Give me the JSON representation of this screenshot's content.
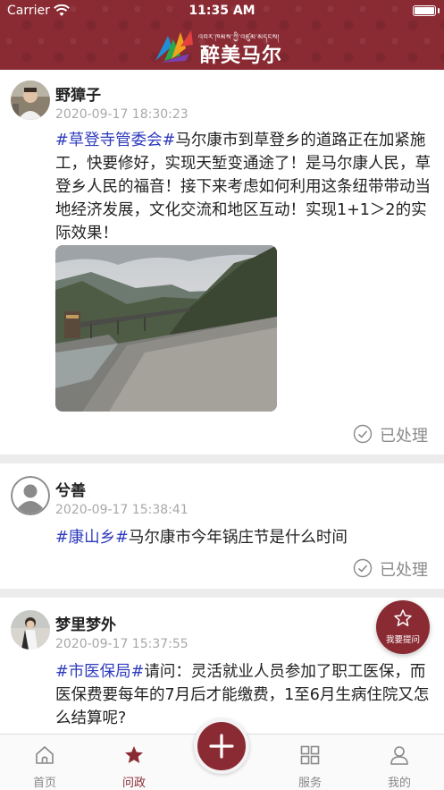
{
  "status_bar": {
    "carrier": "Carrier",
    "time": "11:35 AM"
  },
  "header": {
    "tibetan": "འབར་ཁམས་ཀྱི་འཛུམ་མདངས།",
    "title": "醉美马尔康",
    "brand_color": "#8a2a33"
  },
  "posts": [
    {
      "username": "野獐子",
      "timestamp": "2020-09-17 18:30:23",
      "topic": "#草登寺管委会#",
      "text": "马尔康市到草登乡的道路正在加紧施工，快要修好，实现天堑变通途了！是马尔康人民，草登乡人民的福音！接下来考虑如何利用这条纽带带动当地经济发展，文化交流和地区互动！实现1+1＞2的实际效果！",
      "status": "已处理"
    },
    {
      "username": "兮善",
      "timestamp": "2020-09-17 15:38:41",
      "topic": "#康山乡#",
      "text": "马尔康市今年锅庄节是什么时间",
      "status": "已处理"
    },
    {
      "username": "梦里梦外",
      "timestamp": "2020-09-17 15:37:55",
      "topic": "#市医保局#",
      "text": "请问：灵活就业人员参加了职工医保，而医保费要每年的7月后才能缴费，1至6月生病住院又怎么结算呢?"
    }
  ],
  "fab": {
    "label": "我要提问"
  },
  "tabs": [
    {
      "label": "首页",
      "icon": "home-icon"
    },
    {
      "label": "问政",
      "icon": "star-icon",
      "active": true
    },
    {
      "label": "服务",
      "icon": "grid-icon"
    },
    {
      "label": "我的",
      "icon": "person-icon"
    }
  ],
  "colors": {
    "topic": "#2e3bbd",
    "accent": "#8a2a33",
    "muted": "#8a8a8a"
  }
}
